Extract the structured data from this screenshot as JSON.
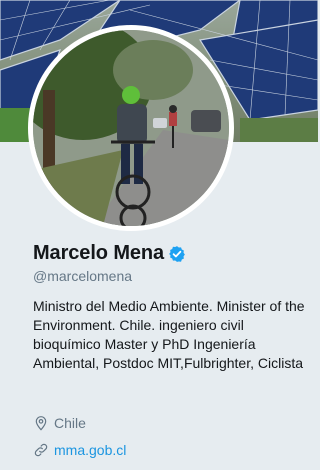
{
  "profile": {
    "name": "Marcelo Mena",
    "handle": "@marcelomena",
    "verified": true,
    "bio": "Ministro del Medio Ambiente. Minister of the Environment. Chile. ingeniero civil bioquímico Master y PhD Ingeniería Ambiental, Postdoc MIT,Fulbrighter, Ciclista",
    "location": "Chile",
    "url": "mma.gob.cl"
  },
  "icons": {
    "verified": "verified-badge-icon",
    "location": "location-pin-icon",
    "link": "link-icon"
  },
  "colors": {
    "background": "#e6ecf0",
    "link": "#1b95e0",
    "verified": "#1da1f2",
    "secondary_text": "#657786"
  }
}
